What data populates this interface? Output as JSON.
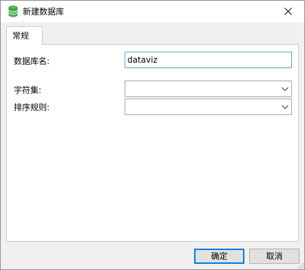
{
  "window": {
    "title": "新建数据库",
    "icon": "database-icon",
    "close_icon": "close-icon"
  },
  "tabs": [
    {
      "label": "常规",
      "active": true
    }
  ],
  "form": {
    "db_name_label": "数据库名:",
    "db_name_value": "dataviz",
    "charset_label": "字符集:",
    "charset_value": "",
    "collation_label": "排序规则:",
    "collation_value": ""
  },
  "buttons": {
    "ok": "确定",
    "cancel": "取消"
  },
  "colors": {
    "icon_green": "#4caf50",
    "focus_border": "#4fa9c0",
    "primary_border": "#0078d7"
  }
}
